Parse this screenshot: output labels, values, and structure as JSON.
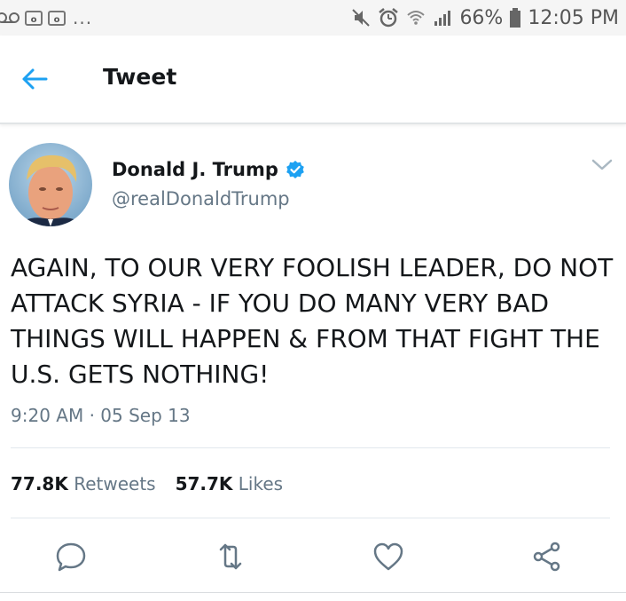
{
  "status_bar": {
    "battery": "66%",
    "time": "12:05 PM",
    "more": "...",
    "icons": [
      "voicemail-icon",
      "outlook-icon",
      "outlook-icon",
      "mute-icon",
      "alarm-icon",
      "wifi-icon",
      "signal-icon",
      "battery-icon"
    ]
  },
  "header": {
    "title": "Tweet",
    "back_icon": "arrow-left-icon"
  },
  "tweet": {
    "author_name": "Donald J. Trump",
    "verified": true,
    "handle": "@realDonaldTrump",
    "text": "AGAIN, TO OUR VERY FOOLISH LEADER, DO NOT ATTACK SYRIA - IF YOU DO MANY VERY BAD THINGS WILL HAPPEN & FROM THAT FIGHT THE U.S. GETS NOTHING!",
    "timestamp": "9:20 AM · 05 Sep 13",
    "retweets_count": "77.8K",
    "retweets_label": "Retweets",
    "likes_count": "57.7K",
    "likes_label": "Likes"
  },
  "actions": [
    "reply-icon",
    "retweet-icon",
    "like-icon",
    "share-icon"
  ],
  "colors": {
    "accent": "#1da1f2",
    "secondary_text": "#657786",
    "primary_text": "#14171a"
  }
}
